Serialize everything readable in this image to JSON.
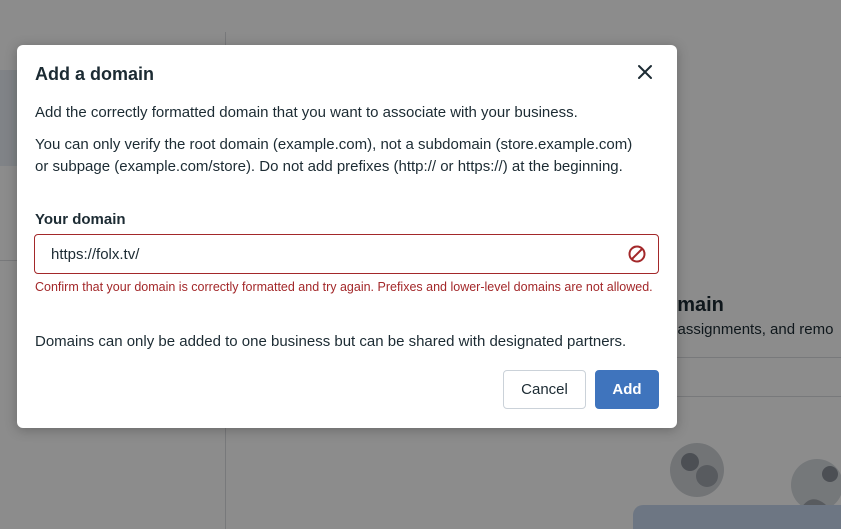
{
  "background": {
    "heading": "omain",
    "subtext": "e assignments, and remo"
  },
  "dialog": {
    "title": "Add a domain",
    "intro": "Add the correctly formatted domain that you want to associate with your business.",
    "rules": "You can only verify the root domain (example.com), not a subdomain (store.example.com) or subpage (example.com/store). Do not add prefixes (http:// or https://) at the beginning.",
    "field_label": "Your domain",
    "field_value": "https://folx.tv/",
    "error": "Confirm that your domain is correctly formatted and try again. Prefixes and lower-level domains are not allowed.",
    "note": "Domains can only be added to one business but can be shared with designated partners.",
    "cancel_label": "Cancel",
    "add_label": "Add"
  },
  "colors": {
    "accent": "#3f74bd",
    "error": "#a3282a",
    "text": "#1c2b33"
  },
  "icons": {
    "close": "close-icon",
    "error": "prohibited-icon"
  }
}
